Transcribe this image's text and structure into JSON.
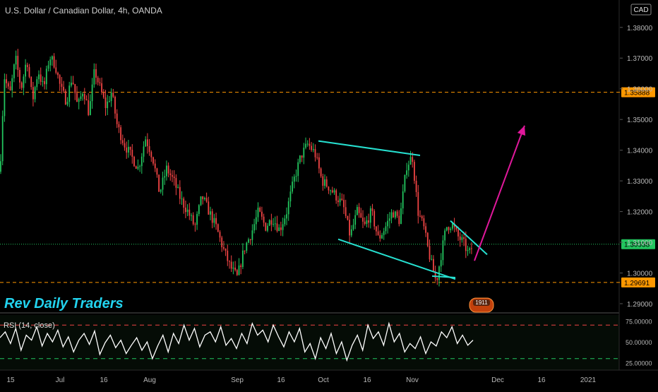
{
  "chart_data": [
    {
      "type": "candlestick",
      "title": "U.S. Dollar / Canadian Dollar, 4h, OANDA",
      "currency_badge": "CAD",
      "watermark": "Rev Daily Traders",
      "badge_label": "1911",
      "x_ticks": [
        "15",
        "Jul",
        "16",
        "Aug",
        "Sep",
        "16",
        "Oct",
        "16",
        "Nov",
        "Dec",
        "16",
        "2021"
      ],
      "y_ticks": [
        "1.29000",
        "1.30000",
        "1.31000",
        "1.32000",
        "1.33000",
        "1.34000",
        "1.35000",
        "1.36000",
        "1.37000",
        "1.38000"
      ],
      "ylim": [
        1.287,
        1.388
      ],
      "price_labels": {
        "resistance": "1.35888",
        "current": "1.30938",
        "support": "1.29691"
      },
      "levels": [
        {
          "name": "resistance",
          "value": 1.35888,
          "style": "dashed",
          "color": "#ff9800"
        },
        {
          "name": "current",
          "value": 1.30938,
          "style": "dotted",
          "color": "#22c55e"
        },
        {
          "name": "support",
          "value": 1.29691,
          "style": "dashed",
          "color": "#ff9800"
        }
      ],
      "price_path": [
        [
          0,
          1.333
        ],
        [
          6,
          1.364
        ],
        [
          14,
          1.358
        ],
        [
          22,
          1.37
        ],
        [
          30,
          1.36
        ],
        [
          38,
          1.37
        ],
        [
          46,
          1.356
        ],
        [
          54,
          1.366
        ],
        [
          62,
          1.36
        ],
        [
          70,
          1.3705
        ],
        [
          78,
          1.368
        ],
        [
          86,
          1.36
        ],
        [
          94,
          1.356
        ],
        [
          102,
          1.364
        ],
        [
          110,
          1.354
        ],
        [
          118,
          1.36
        ],
        [
          126,
          1.352
        ],
        [
          134,
          1.366
        ],
        [
          142,
          1.36
        ],
        [
          150,
          1.354
        ],
        [
          158,
          1.359
        ],
        [
          166,
          1.348
        ],
        [
          176,
          1.342
        ],
        [
          186,
          1.338
        ],
        [
          196,
          1.334
        ],
        [
          206,
          1.344
        ],
        [
          216,
          1.338
        ],
        [
          226,
          1.326
        ],
        [
          236,
          1.334
        ],
        [
          246,
          1.33
        ],
        [
          256,
          1.324
        ],
        [
          266,
          1.32
        ],
        [
          276,
          1.315
        ],
        [
          286,
          1.325
        ],
        [
          296,
          1.32
        ],
        [
          306,
          1.315
        ],
        [
          316,
          1.308
        ],
        [
          326,
          1.302
        ],
        [
          336,
          1.2985
        ],
        [
          346,
          1.308
        ],
        [
          356,
          1.313
        ],
        [
          366,
          1.32
        ],
        [
          376,
          1.315
        ],
        [
          386,
          1.318
        ],
        [
          396,
          1.314
        ],
        [
          406,
          1.32
        ],
        [
          416,
          1.33
        ],
        [
          426,
          1.338
        ],
        [
          436,
          1.342
        ],
        [
          446,
          1.339
        ],
        [
          456,
          1.33
        ],
        [
          466,
          1.328
        ],
        [
          476,
          1.325
        ],
        [
          486,
          1.322
        ],
        [
          496,
          1.312
        ],
        [
          506,
          1.32
        ],
        [
          516,
          1.315
        ],
        [
          526,
          1.32
        ],
        [
          536,
          1.311
        ],
        [
          546,
          1.315
        ],
        [
          556,
          1.32
        ],
        [
          566,
          1.317
        ],
        [
          576,
          1.335
        ],
        [
          584,
          1.338
        ],
        [
          592,
          1.32
        ],
        [
          600,
          1.315
        ],
        [
          606,
          1.308
        ],
        [
          612,
          1.302
        ],
        [
          618,
          1.297
        ],
        [
          624,
          1.305
        ],
        [
          632,
          1.315
        ],
        [
          640,
          1.316
        ],
        [
          648,
          1.312
        ],
        [
          656,
          1.31
        ],
        [
          664,
          1.306
        ],
        [
          670,
          1.3094
        ]
      ],
      "trendlines": [
        {
          "name": "upper-channel-line",
          "color": "#26e0d0",
          "from": [
            451,
            1.343
          ],
          "to": [
            595,
            1.3383
          ]
        },
        {
          "name": "lower-channel-line",
          "color": "#26e0d0",
          "from": [
            479,
            1.311
          ],
          "to": [
            645,
            1.298
          ]
        },
        {
          "name": "wedge-upper-line",
          "color": "#26e0d0",
          "from": [
            638,
            1.317
          ],
          "to": [
            690,
            1.306
          ]
        },
        {
          "name": "wedge-lower-line",
          "color": "#26e0d0",
          "from": [
            612,
            1.299
          ],
          "to": [
            645,
            1.2985
          ]
        }
      ],
      "projection": {
        "color": "#e0189b",
        "from": [
          672,
          1.304
        ],
        "to": [
          743,
          1.348
        ]
      }
    },
    {
      "type": "line",
      "title": "RSI (14, close)",
      "y_ticks": [
        "75.00000",
        "50.00000",
        "25.00000"
      ],
      "ylim": [
        18,
        82
      ],
      "levels": [
        {
          "name": "overbought",
          "value": 70,
          "color": "#ef4444"
        },
        {
          "name": "oversold",
          "value": 30,
          "color": "#22c55e"
        }
      ],
      "series": [
        {
          "color": "#ffffff",
          "values": [
            55,
            62,
            48,
            66,
            40,
            58,
            52,
            68,
            45,
            60,
            50,
            64,
            44,
            56,
            38,
            52,
            60,
            47,
            63,
            35,
            49,
            58,
            43,
            52,
            36,
            46,
            55,
            40,
            50,
            30,
            45,
            58,
            38,
            60,
            48,
            70,
            52,
            66,
            44,
            58,
            62,
            50,
            68,
            46,
            54,
            42,
            60,
            48,
            72,
            58,
            64,
            50,
            70,
            56,
            44,
            62,
            50,
            66,
            38,
            48,
            30,
            55,
            42,
            60,
            36,
            50,
            28,
            46,
            58,
            40,
            70,
            54,
            62,
            46,
            72,
            50,
            60,
            38,
            48,
            42,
            56,
            36,
            50,
            45,
            62,
            55,
            68,
            48,
            58,
            46,
            52
          ]
        }
      ]
    }
  ]
}
